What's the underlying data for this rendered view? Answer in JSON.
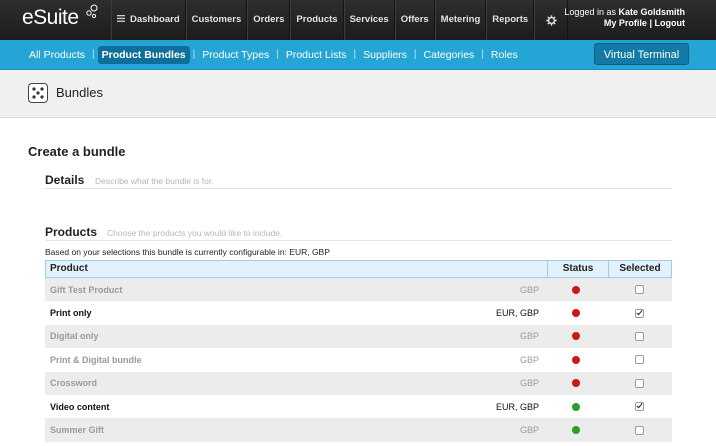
{
  "app": {
    "logo": "eSuite",
    "nav": [
      {
        "label": "Dashboard",
        "icon": "menu-icon"
      },
      {
        "label": "Customers"
      },
      {
        "label": "Orders"
      },
      {
        "label": "Products"
      },
      {
        "label": "Services"
      },
      {
        "label": "Offers"
      },
      {
        "label": "Metering"
      },
      {
        "label": "Reports"
      }
    ],
    "settings_icon": "gear-icon",
    "user": {
      "logged_in_prefix": "Logged in as",
      "name": "Kate Goldsmith",
      "my_profile": "My Profile",
      "separator": "|",
      "logout": "Logout"
    }
  },
  "subnav": {
    "items": [
      "All Products",
      "Product Bundles",
      "Product Types",
      "Product Lists",
      "Suppliers",
      "Categories",
      "Roles"
    ],
    "active": "Product Bundles",
    "separator": "|",
    "virtual_terminal": "Virtual Terminal"
  },
  "page": {
    "title": "Bundles",
    "icon": "bundle-dice-icon"
  },
  "form": {
    "heading": "Create a bundle",
    "details": {
      "title": "Details",
      "description": "Describe what the bundle is for."
    },
    "products": {
      "title": "Products",
      "description": "Choose the products you would like to include.",
      "config_note": "Based on your selections this bundle is currently configurable in: EUR, GBP"
    }
  },
  "table": {
    "columns": [
      "Product",
      "Status",
      "Selected"
    ],
    "rows": [
      {
        "name": "Gift Test Product",
        "currencies": "GBP",
        "status": "red",
        "selected": false
      },
      {
        "name": "Print only",
        "currencies": "EUR, GBP",
        "status": "red",
        "selected": true
      },
      {
        "name": "Digital only",
        "currencies": "GBP",
        "status": "red",
        "selected": false
      },
      {
        "name": "Print & Digital bundle",
        "currencies": "GBP",
        "status": "red",
        "selected": false
      },
      {
        "name": "Crossword",
        "currencies": "GBP",
        "status": "red",
        "selected": false
      },
      {
        "name": "Video content",
        "currencies": "EUR, GBP",
        "status": "green",
        "selected": true
      },
      {
        "name": "Summer Gift",
        "currencies": "GBP",
        "status": "green",
        "selected": false
      }
    ]
  },
  "colors": {
    "topbar": "#222222",
    "subnav": "#25a5d6",
    "active_subnav": "#0e6f9b",
    "status_red": "#c81818",
    "status_green": "#2aa022"
  }
}
